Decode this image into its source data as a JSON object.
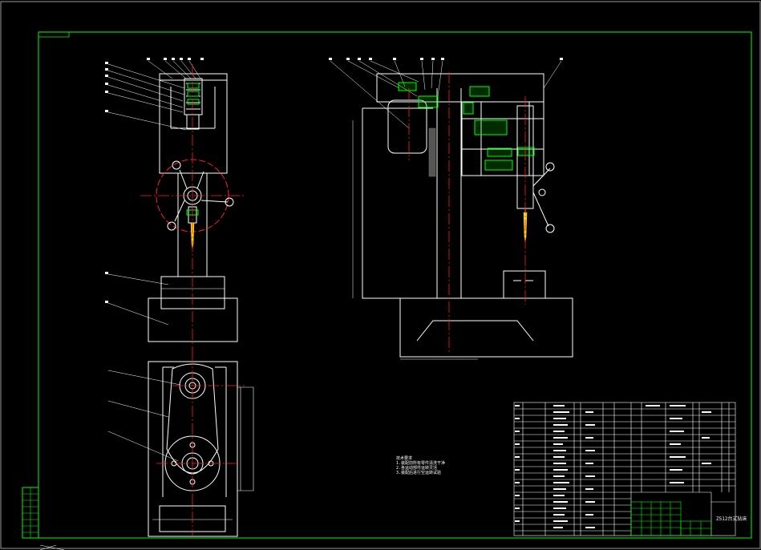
{
  "colors": {
    "background": "#000000",
    "outline": "#ffffff",
    "border": "#00ff00",
    "centerline": "#ff2020",
    "highlight": "#00ff00",
    "drill_bit": "#ffd700"
  },
  "technical_notes": [
    "技术要求",
    "1.装配前所有零件清洗干净",
    "2.各运动部件运转灵活",
    "3.装配后进行空运转试验"
  ],
  "title_block": {
    "drawing_name": "Z512台式钻床"
  }
}
